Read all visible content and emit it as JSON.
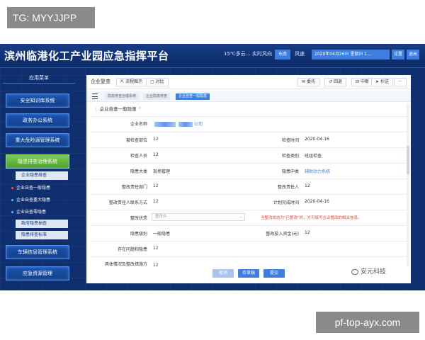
{
  "overlay": {
    "top_tag": "TG: MYYJJPP",
    "bottom_tag": "pf-top-ayx.com",
    "watermark": "安元科技"
  },
  "header": {
    "title": "滨州临港化工产业园应急指挥平台",
    "weather": "15℃多云… 实时风向",
    "dir_btn": "东南",
    "wind_label": "风速",
    "date_text": "2020年04月26日 星期日 1…",
    "settings_btn": "设置",
    "logout_btn": "退出"
  },
  "sidebar": {
    "heading": "应用菜单",
    "items": [
      {
        "label": "安全知识库系统"
      },
      {
        "label": "政务办公系统"
      },
      {
        "label": "重大危险源管理系统"
      },
      {
        "label": "隐患排查治理系统"
      },
      {
        "label": "车辆信息管理系统"
      },
      {
        "label": "应急资源管理"
      }
    ],
    "subitems": [
      {
        "label": "企业隐患排查"
      },
      {
        "label": "企业自查一般隐患"
      },
      {
        "label": "企业自查重大隐患"
      },
      {
        "label": "企业自查零隐患"
      },
      {
        "label": "政府隐患抽查"
      },
      {
        "label": "隐患排查标准"
      }
    ]
  },
  "panel": {
    "tab_title": "企业复查",
    "tab_flow": "流程图示",
    "tab_compare": "对比",
    "actions": {
      "delegate": "委托",
      "return": "回退",
      "stop": "中断",
      "cc": "抄送",
      "more": "···"
    },
    "breadcrumbs": [
      "隐患排查治理系统",
      "企业隐患排查",
      "企业自查一般隐患"
    ],
    "section": "企业自查一般隐患",
    "fields": {
      "company_name_label": "企业名称",
      "company_name_suffix": "公司",
      "dept_label": "被检查部位",
      "dept_value": "12",
      "check_time_label": "检查时间",
      "check_time_value": "2020-04-16",
      "inspector_label": "检查人员",
      "inspector_value": "12",
      "check_type_label": "检查类别",
      "check_type_value": "班组检查",
      "hazard_cat_label": "隐患大类",
      "hazard_cat_value": "现场管理",
      "hazard_mid_label": "隐患中类",
      "hazard_mid_value": "辅助动力系统",
      "resp_dept_label": "整改责任部门",
      "resp_dept_value": "12",
      "resp_person_label": "整改责任人",
      "resp_person_value": "12",
      "contact_label": "整改责任人联系方式",
      "contact_value": "12",
      "plan_date_label": "计划完成时间",
      "plan_date_value": "2020-04-16",
      "status_label": "整改状态",
      "status_value": "整改中",
      "status_note": "当整改状态为\"已整改\"时，方可填写企业整改的相关信息。",
      "level_label": "隐患级别",
      "level_value": "一般隐患",
      "fund_label": "整改投入资金(元)",
      "fund_value": "12",
      "problem_label": "存在问题和隐患",
      "problem_value": "12",
      "measure_label": "具体情况及整改措施方",
      "measure_value": "12"
    },
    "buttons": {
      "cancel": "取消",
      "save_draft": "存草稿",
      "submit": "提交"
    }
  }
}
